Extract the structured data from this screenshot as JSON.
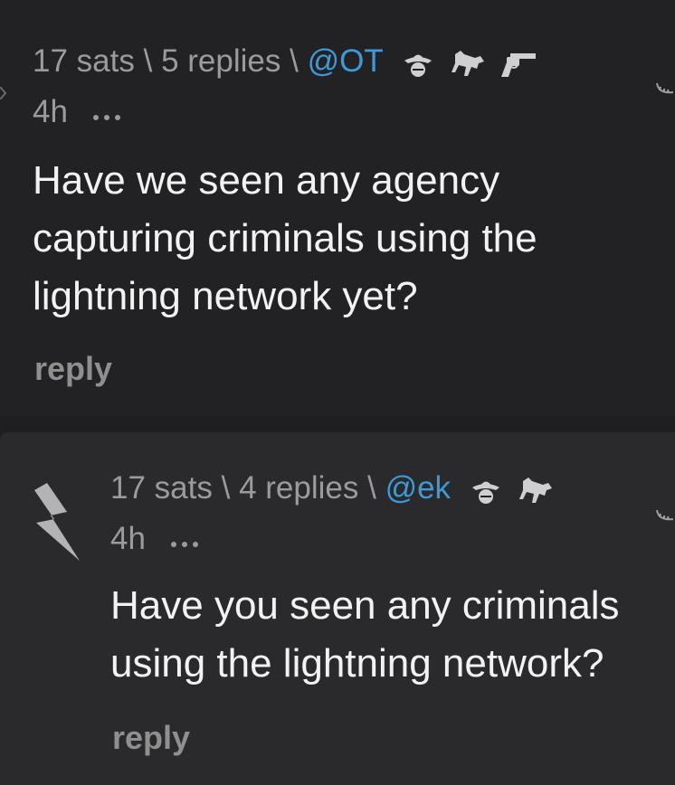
{
  "comments": [
    {
      "sats": "17 sats",
      "sep1": "\\",
      "replies": "5 replies",
      "sep2": "\\",
      "user": "@OT",
      "time": "4h",
      "badges": [
        "cowboy-hat-icon",
        "horse-icon",
        "revolver-icon"
      ],
      "text": "Have we seen any agency capturing criminals using the lightning network yet?",
      "reply_label": "reply"
    },
    {
      "sats": "17 sats",
      "sep1": "\\",
      "replies": "4 replies",
      "sep2": "\\",
      "user": "@ek",
      "time": "4h",
      "badges": [
        "cowboy-hat-icon",
        "horse-icon"
      ],
      "text": "Have you seen any criminals using the lightning network?",
      "reply_label": "reply"
    }
  ],
  "colors": {
    "background": "#1f1f21",
    "top_comment_bg": "#222225",
    "nested_comment_bg": "#2a2a2d",
    "meta_text": "#9b9b9b",
    "user_link": "#3d9ad8",
    "body_text": "#f2f2f2",
    "reply_link": "#8f8f8f"
  }
}
